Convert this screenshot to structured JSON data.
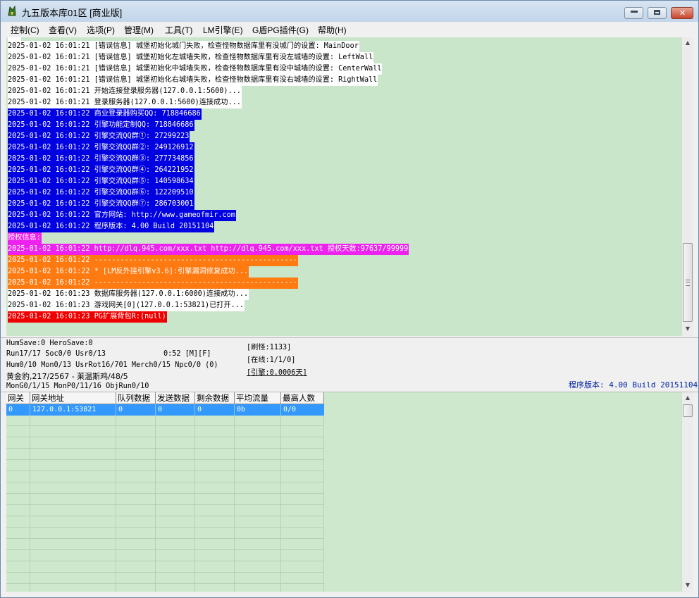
{
  "window": {
    "title": "九五版本库01区 [商业版]",
    "controls": {
      "minimize": "▬",
      "maximize": "▭",
      "close": "✕"
    }
  },
  "menu": [
    "控制(C)",
    "查看(V)",
    "选项(P)",
    "管理(M)",
    "工具(T)",
    "LM引擎(E)",
    "G盾PG插件(G)",
    "帮助(H)"
  ],
  "log": {
    "partial_top_line": "...",
    "lines": [
      {
        "text": "2025-01-02 16:01:21 [错误信息] 城堡初始化城门失败，检查怪物数据库里有没城门的设置: MainDoor",
        "color": "white"
      },
      {
        "text": "2025-01-02 16:01:21 [错误信息] 城堡初始化左城墙失败，检查怪物数据库里有没左城墙的设置: LeftWall",
        "color": "white"
      },
      {
        "text": "2025-01-02 16:01:21 [错误信息] 城堡初始化中城墙失败，检查怪物数据库里有没中城墙的设置: CenterWall",
        "color": "white"
      },
      {
        "text": "2025-01-02 16:01:21 [错误信息] 城堡初始化右城墙失败，检查怪物数据库里有没右城墙的设置: RightWall",
        "color": "white"
      },
      {
        "text": "2025-01-02 16:01:21 开始连接登录服务器(127.0.0.1:5600)...",
        "color": "white"
      },
      {
        "text": "2025-01-02 16:01:21 登录服务器(127.0.0.1:5600)连接成功...",
        "color": "white"
      },
      {
        "text": "2025-01-02 16:01:22 商业登录器购买QQ: 718846686",
        "color": "blue"
      },
      {
        "text": "2025-01-02 16:01:22 引擎功能定制QQ: 718846686",
        "color": "blue"
      },
      {
        "text": "2025-01-02 16:01:22 引擎交流QQ群①: 27299223",
        "color": "blue"
      },
      {
        "text": "2025-01-02 16:01:22 引擎交流QQ群②: 249126912",
        "color": "blue"
      },
      {
        "text": "2025-01-02 16:01:22 引擎交流QQ群③: 277734856",
        "color": "blue"
      },
      {
        "text": "2025-01-02 16:01:22 引擎交流QQ群④: 264221952",
        "color": "blue"
      },
      {
        "text": "2025-01-02 16:01:22 引擎交流QQ群⑤: 140598634",
        "color": "blue"
      },
      {
        "text": "2025-01-02 16:01:22 引擎交流QQ群⑥: 122209510",
        "color": "blue"
      },
      {
        "text": "2025-01-02 16:01:22 引擎交流QQ群⑦: 286703001",
        "color": "blue"
      },
      {
        "text": "2025-01-02 16:01:22 官方网站: http://www.gameofmir.com",
        "color": "blue"
      },
      {
        "text": "2025-01-02 16:01:22 程序版本: 4.00 Build 20151104",
        "color": "blue"
      },
      {
        "text": "授权信息:",
        "color": "magenta"
      },
      {
        "text": "2025-01-02 16:01:22 http://dlq.945.com/xxx.txt http://dlq.945.com/xxx.txt 授权天数:97637/99999",
        "color": "magenta"
      },
      {
        "text": "2025-01-02 16:01:22 -----------------------------------------------",
        "color": "orange"
      },
      {
        "text": "2025-01-02 16:01:22 * [LM反外挂引擎v3.6]:引擎漏洞修复成功...",
        "color": "orange"
      },
      {
        "text": "2025-01-02 16:01:22 -----------------------------------------------",
        "color": "orange"
      },
      {
        "text": "2025-01-02 16:01:23 数据库服务器(127.0.0.1:6000)连接成功...",
        "color": "white"
      },
      {
        "text": "2025-01-02 16:01:23 游戏网关[0](127.0.0.1:53821)已打开...",
        "color": "white"
      },
      {
        "text": "2025-01-02 16:01:23 PG扩展背包R:(null)",
        "color": "red"
      }
    ]
  },
  "status": {
    "line1": "HumSave:0 HeroSave:0",
    "line2": "Run17/17 Soc0/0 Usr0/13",
    "timer": "0:52 [M][F]",
    "line3": "Hum0/10 Mon0/13 UsrRot16/701 Merch0/15 Npc0/0 (0)",
    "line4": "黄金豹,217/2567 - 莱温斯鸡/48/5",
    "line5": "MonG0/1/15 MonP0/11/16 ObjRun0/10",
    "refresh_monster": "[刷怪:1133]",
    "online": "[在线:1/1/0]",
    "engine": "[引擎:0.0006天]",
    "version": "程序版本: 4.00 Build 20151104"
  },
  "gateway_table": {
    "columns": [
      "网关",
      "网关地址",
      "队列数据",
      "发送数据",
      "剩余数据",
      "平均流量",
      "最高人数"
    ],
    "rows": [
      [
        "0",
        "127.0.0.1:53821",
        "0",
        "0",
        "0",
        "0b",
        "0/0"
      ]
    ]
  },
  "colors": {
    "log_background": "#c9e6cb",
    "blue": "#0000e0",
    "magenta": "#ee22ee",
    "orange": "#ff7a10",
    "red": "#ee0000",
    "selection": "#3399ff"
  }
}
